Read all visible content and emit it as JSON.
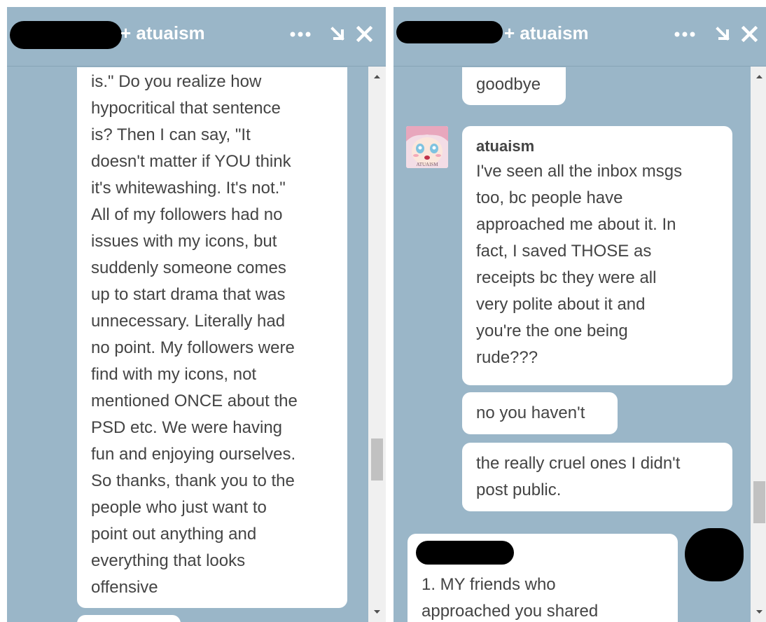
{
  "left_chat": {
    "title": "+ atuaism",
    "more_label": "•••",
    "message_lines": [
      "is.\" Do you realize how",
      "hypocritical that sentence",
      "is? Then I can say, \"It",
      "doesn't matter if YOU think",
      "it's whitewashing. It's not.\"",
      "All of my followers had no",
      "issues with my icons, but",
      "suddenly someone comes",
      "up to start drama that was",
      "unnecessary. Literally had",
      "no point. My followers were",
      "find with my icons, not",
      "mentioned ONCE about the",
      "PSD etc. We were having",
      "fun and enjoying ourselves.",
      "So thanks, thank you to the",
      "people who just want to",
      "point out anything and",
      "everything that looks",
      "offensive"
    ]
  },
  "right_chat": {
    "title": "+ atuaism",
    "more_label": "•••",
    "msg_goodbye": "goodbye",
    "sender_name": "atuaism",
    "avatar_caption": "ATUAISM",
    "msg_inbox_lines": [
      "I've seen all the inbox msgs",
      "too, bc people have",
      "approached me about it. In",
      "fact, I saved THOSE as",
      "receipts bc they were all",
      "very polite about it and",
      "you're the one being",
      "rude???"
    ],
    "msg_no": "no you haven't",
    "msg_cruel_lines": [
      "the really cruel ones I didn't",
      "post public."
    ],
    "msg_reply_lines": [
      "1. MY friends who",
      "approached you shared"
    ]
  },
  "colors": {
    "panel_bg": "#9ab6c8",
    "bubble_bg": "#ffffff",
    "text": "#444444",
    "scrollbar_track": "#f0f0f0",
    "scrollbar_thumb": "#c1c1c1"
  }
}
